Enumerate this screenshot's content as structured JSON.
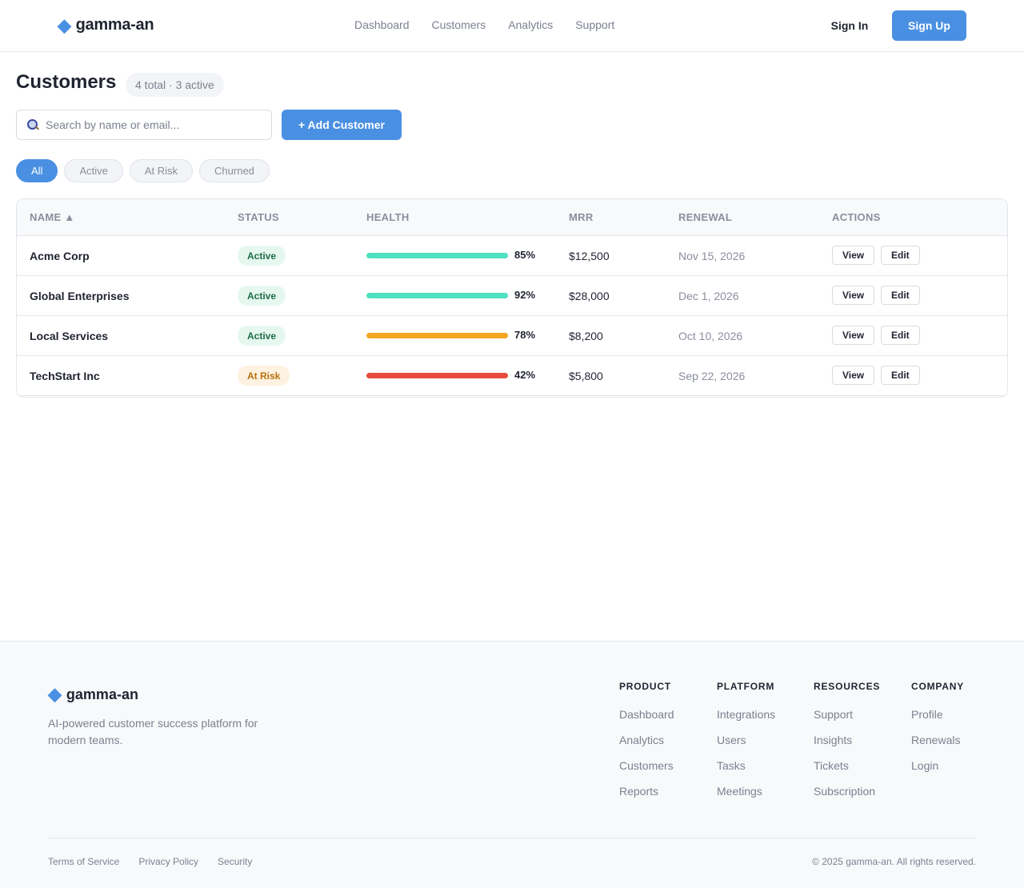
{
  "header": {
    "brand": "gamma-an",
    "nav": [
      "Dashboard",
      "Customers",
      "Analytics",
      "Support"
    ],
    "sign_in": "Sign In",
    "sign_up": "Sign Up"
  },
  "page": {
    "title": "Customers",
    "count_badge": "4 total · 3 active"
  },
  "search": {
    "placeholder": "Search by name or email...",
    "value": ""
  },
  "add_button": "+ Add Customer",
  "filters": [
    "All",
    "Active",
    "At Risk",
    "Churned"
  ],
  "active_filter": "All",
  "table": {
    "headers": [
      "NAME ▲",
      "STATUS",
      "HEALTH",
      "MRR",
      "RENEWAL",
      "ACTIONS"
    ],
    "rows": [
      {
        "name": "Acme Corp",
        "status": "Active",
        "health": 85,
        "health_label": "85%",
        "health_color": "#4fe0bf",
        "mrr": "$12,500",
        "renewal": "Nov 15, 2026"
      },
      {
        "name": "Global Enterprises",
        "status": "Active",
        "health": 92,
        "health_label": "92%",
        "health_color": "#4fe0bf",
        "mrr": "$28,000",
        "renewal": "Dec 1, 2026"
      },
      {
        "name": "Local Services",
        "status": "Active",
        "health": 78,
        "health_label": "78%",
        "health_color": "#f5a623",
        "mrr": "$8,200",
        "renewal": "Oct 10, 2026"
      },
      {
        "name": "TechStart Inc",
        "status": "At Risk",
        "health": 42,
        "health_label": "42%",
        "health_color": "#e74c3c",
        "mrr": "$5,800",
        "renewal": "Sep 22, 2026"
      }
    ],
    "view_label": "View",
    "edit_label": "Edit"
  },
  "footer": {
    "brand": "gamma-an",
    "tagline": "AI-powered customer success platform for modern teams.",
    "columns": [
      {
        "title": "PRODUCT",
        "links": [
          "Dashboard",
          "Analytics",
          "Customers",
          "Reports"
        ]
      },
      {
        "title": "PLATFORM",
        "links": [
          "Integrations",
          "Users",
          "Tasks",
          "Meetings"
        ]
      },
      {
        "title": "RESOURCES",
        "links": [
          "Support",
          "Insights",
          "Tickets",
          "Subscription"
        ]
      },
      {
        "title": "COMPANY",
        "links": [
          "Profile",
          "Renewals",
          "Login"
        ]
      }
    ],
    "legal": [
      "Terms of Service",
      "Privacy Policy",
      "Security"
    ],
    "copyright": "© 2025 gamma-an. All rights reserved."
  },
  "colors": {
    "accent": "#4a90e2",
    "active_badge_bg": "#e6f7ef",
    "risk_badge_bg": "#fdf1e1"
  },
  "icons": {
    "logo": "diamond-icon",
    "search": "search-icon"
  }
}
